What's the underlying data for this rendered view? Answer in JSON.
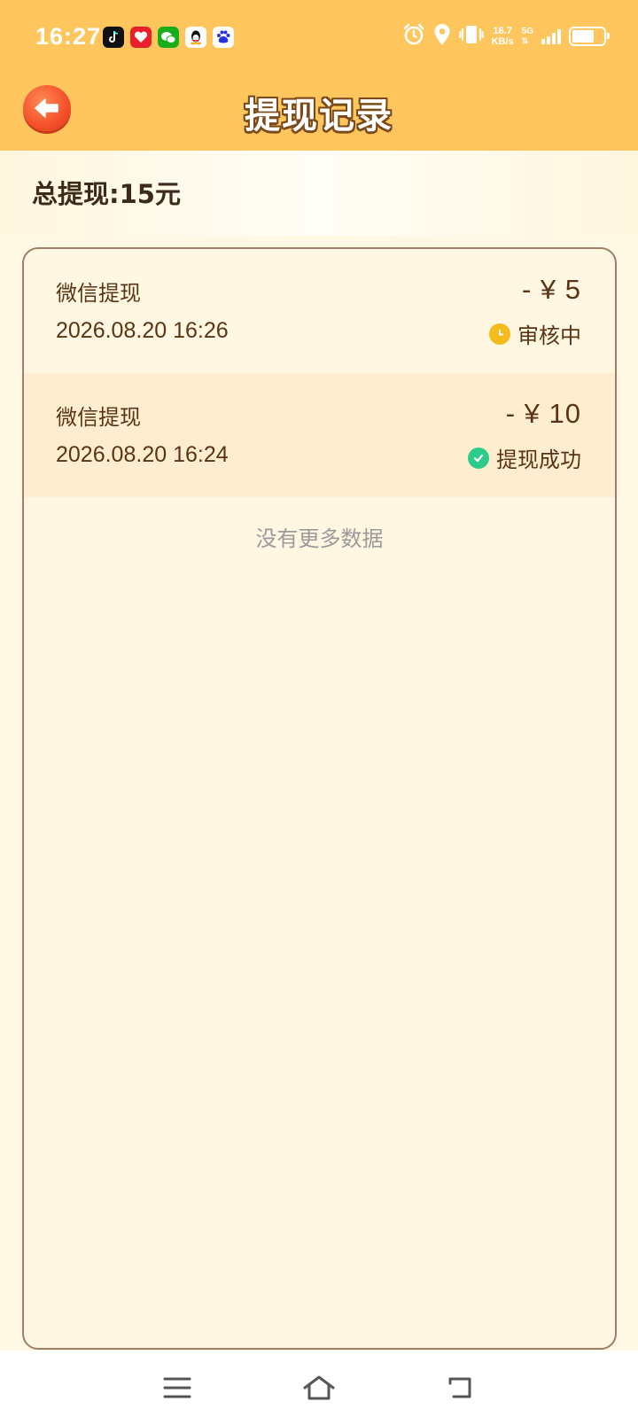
{
  "status_bar": {
    "time": "16:27",
    "net_speed_value": "18.7",
    "net_speed_unit": "KB/s",
    "net_type": "5G",
    "app_icons": [
      "tiktok-icon",
      "red-app-icon",
      "wechat-icon",
      "qq-icon",
      "baidu-icon"
    ],
    "system_icons": [
      "alarm-icon",
      "location-icon",
      "vibrate-icon",
      "signal-icon",
      "battery-icon"
    ]
  },
  "header": {
    "title": "提现记录",
    "back_icon": "back-arrow-icon"
  },
  "summary": {
    "text": "总提现:15元"
  },
  "records": [
    {
      "method": "微信提现",
      "date": "2026.08.20 16:26",
      "amount": "- ¥ 5",
      "status": "审核中",
      "status_icon": "clock-icon",
      "status_color": "#f5bb1c"
    },
    {
      "method": "微信提现",
      "date": "2026.08.20 16:24",
      "amount": "- ¥ 10",
      "status": "提现成功",
      "status_icon": "check-circle-icon",
      "status_color": "#2ecc8a"
    }
  ],
  "list_footer": "没有更多数据",
  "nav_bar": {
    "icons": [
      "menu-icon",
      "home-icon",
      "back-icon"
    ]
  },
  "colors": {
    "header_bg": "#ffc65e",
    "page_bg": "#fff8e4",
    "text_brown": "#5a3414",
    "back_button": "#f4502a"
  }
}
